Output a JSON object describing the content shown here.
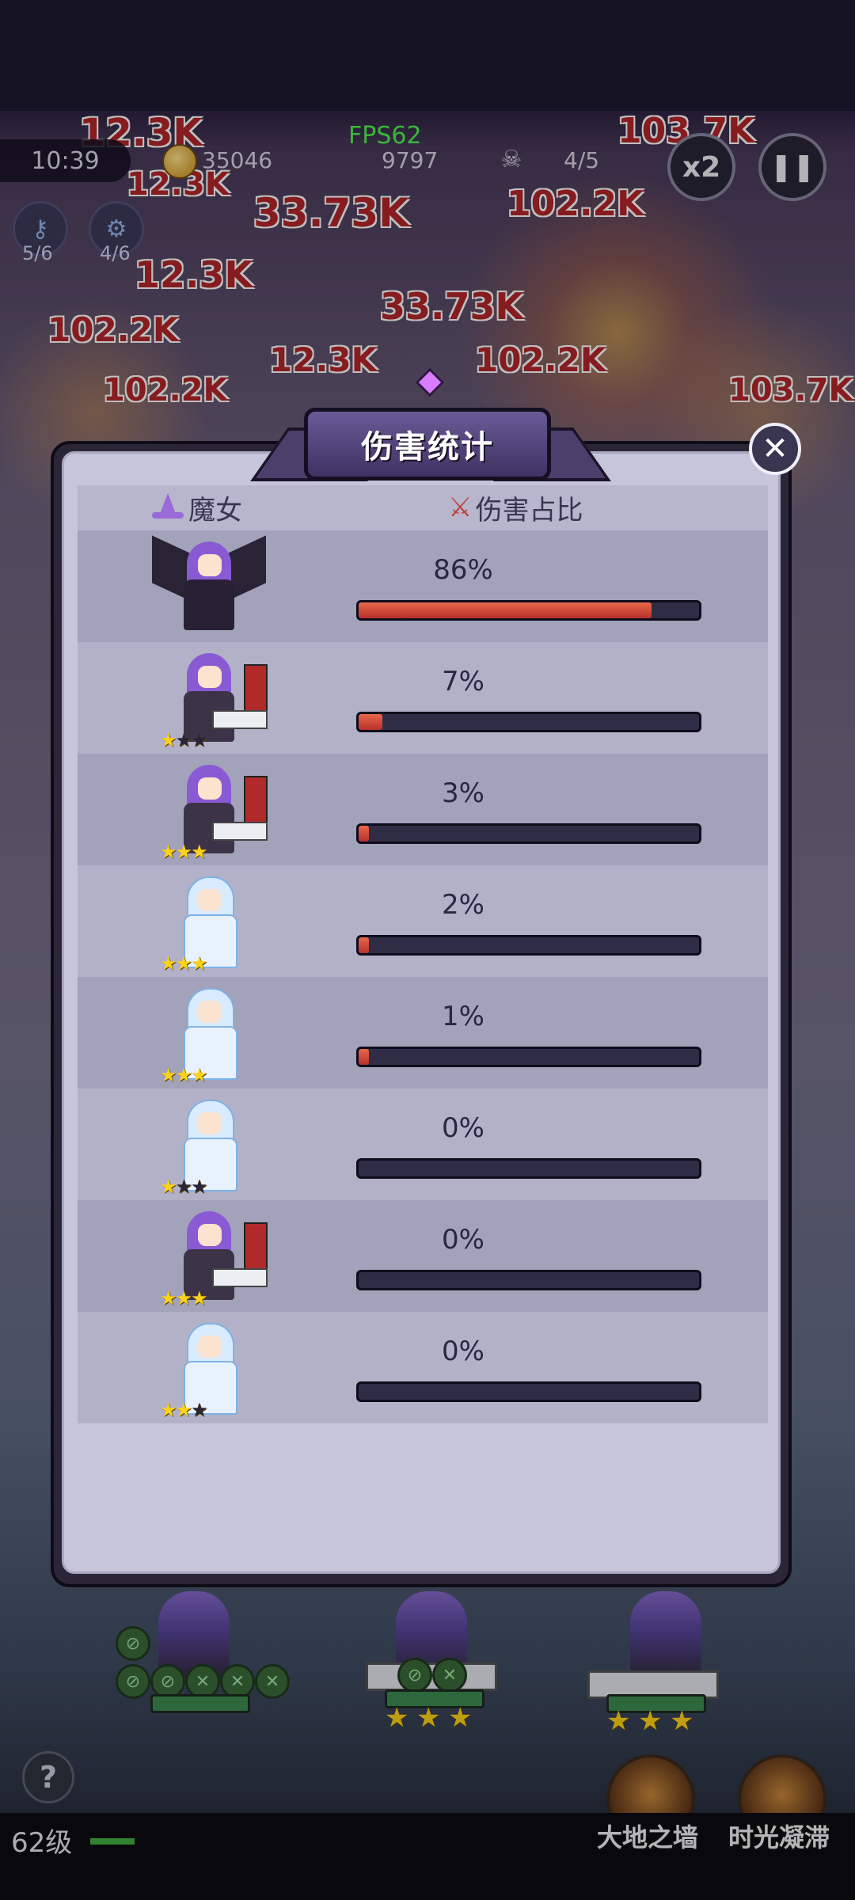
{
  "hud": {
    "time": "10:39",
    "gold": "35046",
    "fps": "FPS62",
    "kills": "9797",
    "wave": "4/5",
    "speed": "x2",
    "pause_glyph": "❚❚",
    "skill_a_count": "5/6",
    "skill_b_count": "4/6",
    "icons": [
      "clock-icon",
      "coin-icon",
      "skull-icon",
      "key-icon",
      "gear-icon",
      "pause-icon"
    ]
  },
  "background_damage_numbers": [
    "12.3K",
    "33.73K",
    "102.2K",
    "103.7K",
    "12.3K",
    "33.73K",
    "102.2K",
    "12.3K",
    "102.2K",
    "12.3K",
    "102.2K",
    "103.7K"
  ],
  "panel": {
    "title": "伤害统计",
    "close_glyph": "✕",
    "columns": {
      "hero": "魔女",
      "share": "伤害占比"
    },
    "rows": [
      {
        "percent": "86%",
        "fill": 0.86,
        "hero": "winged-witch",
        "stars": 0
      },
      {
        "percent": "7%",
        "fill": 0.07,
        "hero": "purple-witch",
        "stars": 1
      },
      {
        "percent": "3%",
        "fill": 0.03,
        "hero": "purple-witch",
        "stars": 3
      },
      {
        "percent": "2%",
        "fill": 0.02,
        "hero": "ice-maiden",
        "stars": 3
      },
      {
        "percent": "1%",
        "fill": 0.01,
        "hero": "ice-maiden",
        "stars": 3
      },
      {
        "percent": "0%",
        "fill": 0.0,
        "hero": "ice-maiden",
        "stars": 1
      },
      {
        "percent": "0%",
        "fill": 0.0,
        "hero": "purple-witch",
        "stars": 3
      },
      {
        "percent": "0%",
        "fill": 0.0,
        "hero": "ice-maiden",
        "stars": 2
      }
    ]
  },
  "bottom": {
    "help_glyph": "?",
    "level": "62级",
    "skill1": "大地之墙",
    "skill2": "时光凝滞"
  },
  "colors": {
    "bar_fill": "#d94a36",
    "bar_track": "#2f2c46",
    "panel_bg": "#c6c5da",
    "row_dark": "#a3a2bb",
    "row_light": "#b2b1c8",
    "fps": "#4ff04f"
  }
}
